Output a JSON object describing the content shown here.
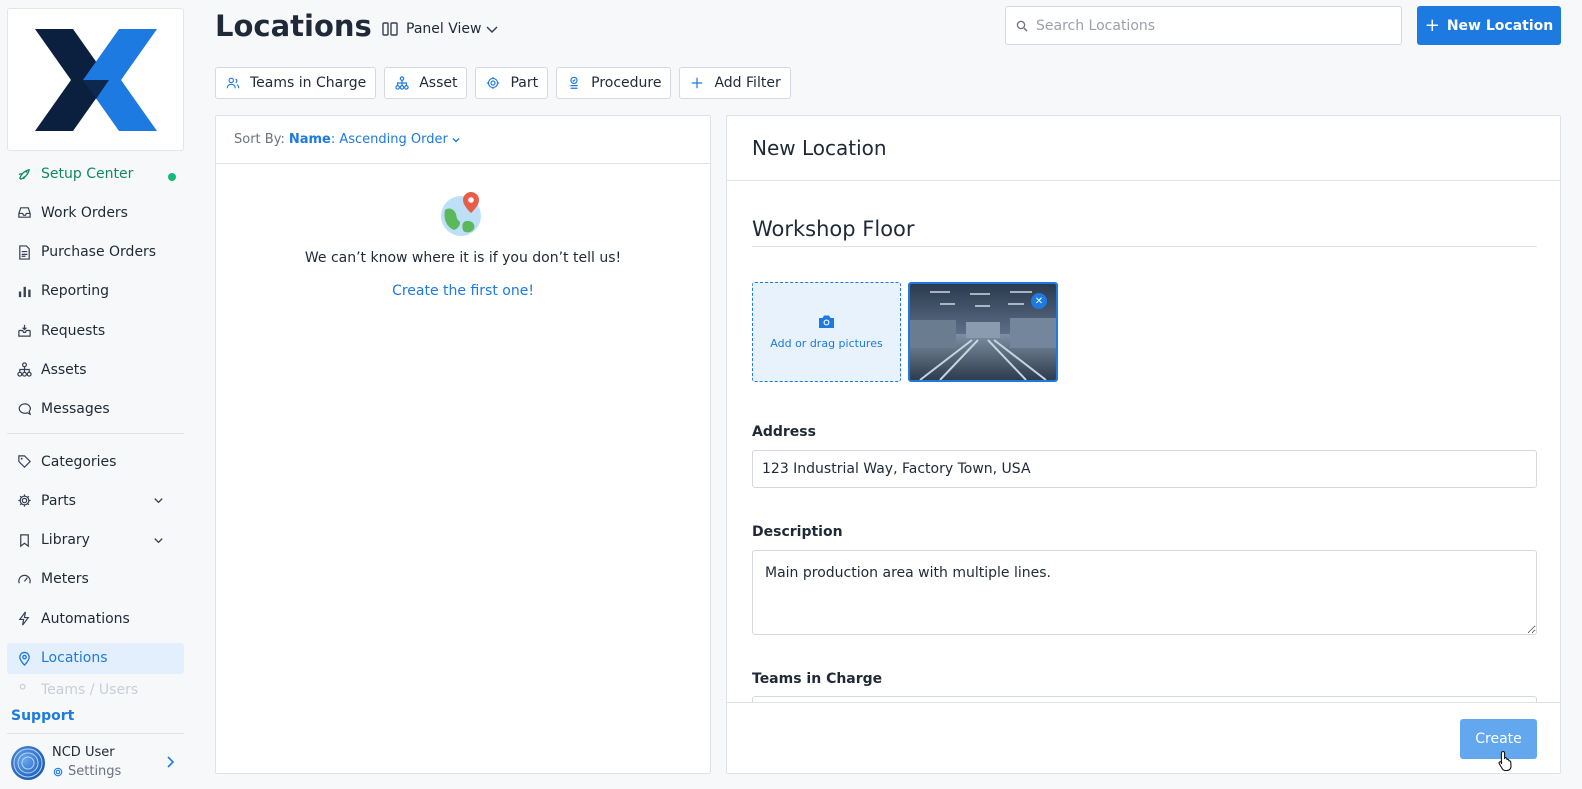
{
  "sidebar": {
    "items": [
      {
        "label": "Setup Center",
        "icon": "rocket-icon"
      },
      {
        "label": "Work Orders",
        "icon": "inbox-icon"
      },
      {
        "label": "Purchase Orders",
        "icon": "document-icon"
      },
      {
        "label": "Reporting",
        "icon": "bar-chart-icon"
      },
      {
        "label": "Requests",
        "icon": "tray-icon"
      },
      {
        "label": "Assets",
        "icon": "hierarchy-icon"
      },
      {
        "label": "Messages",
        "icon": "chat-icon"
      },
      {
        "label": "Categories",
        "icon": "tag-icon"
      },
      {
        "label": "Parts",
        "icon": "gear-icon"
      },
      {
        "label": "Library",
        "icon": "bookmark-icon"
      },
      {
        "label": "Meters",
        "icon": "gauge-icon"
      },
      {
        "label": "Automations",
        "icon": "lightning-icon"
      },
      {
        "label": "Locations",
        "icon": "map-pin-icon"
      },
      {
        "label": "Teams / Users",
        "icon": "users-icon"
      }
    ],
    "support_label": "Support",
    "user": {
      "name": "NCD User",
      "settings_label": "Settings"
    }
  },
  "header": {
    "title": "Locations",
    "view_label": "Panel View",
    "search_placeholder": "Search Locations",
    "new_button_label": "New Location"
  },
  "filters": [
    "Teams in Charge",
    "Asset",
    "Part",
    "Procedure",
    "Add Filter"
  ],
  "list": {
    "sort_prefix": "Sort By:",
    "sort_field": "Name",
    "sort_order": "Ascending Order",
    "empty_text": "We can’t know where it is if you don’t tell us!",
    "empty_link": "Create the first one!"
  },
  "form": {
    "title": "New Location",
    "name_value": "Workshop Floor",
    "uploader_label": "Add or drag pictures",
    "address_label": "Address",
    "address_value": "123 Industrial Way, Factory Town, USA",
    "description_label": "Description",
    "description_value": "Main production area with multiple lines.",
    "teams_label": "Teams in Charge",
    "create_label": "Create"
  },
  "colors": {
    "accent": "#1d7ae0",
    "setup_green": "#0f8a5f",
    "status_dot": "#17b978",
    "logo_dark": "#0b1f3f",
    "logo_blue": "#1d7ae0"
  }
}
